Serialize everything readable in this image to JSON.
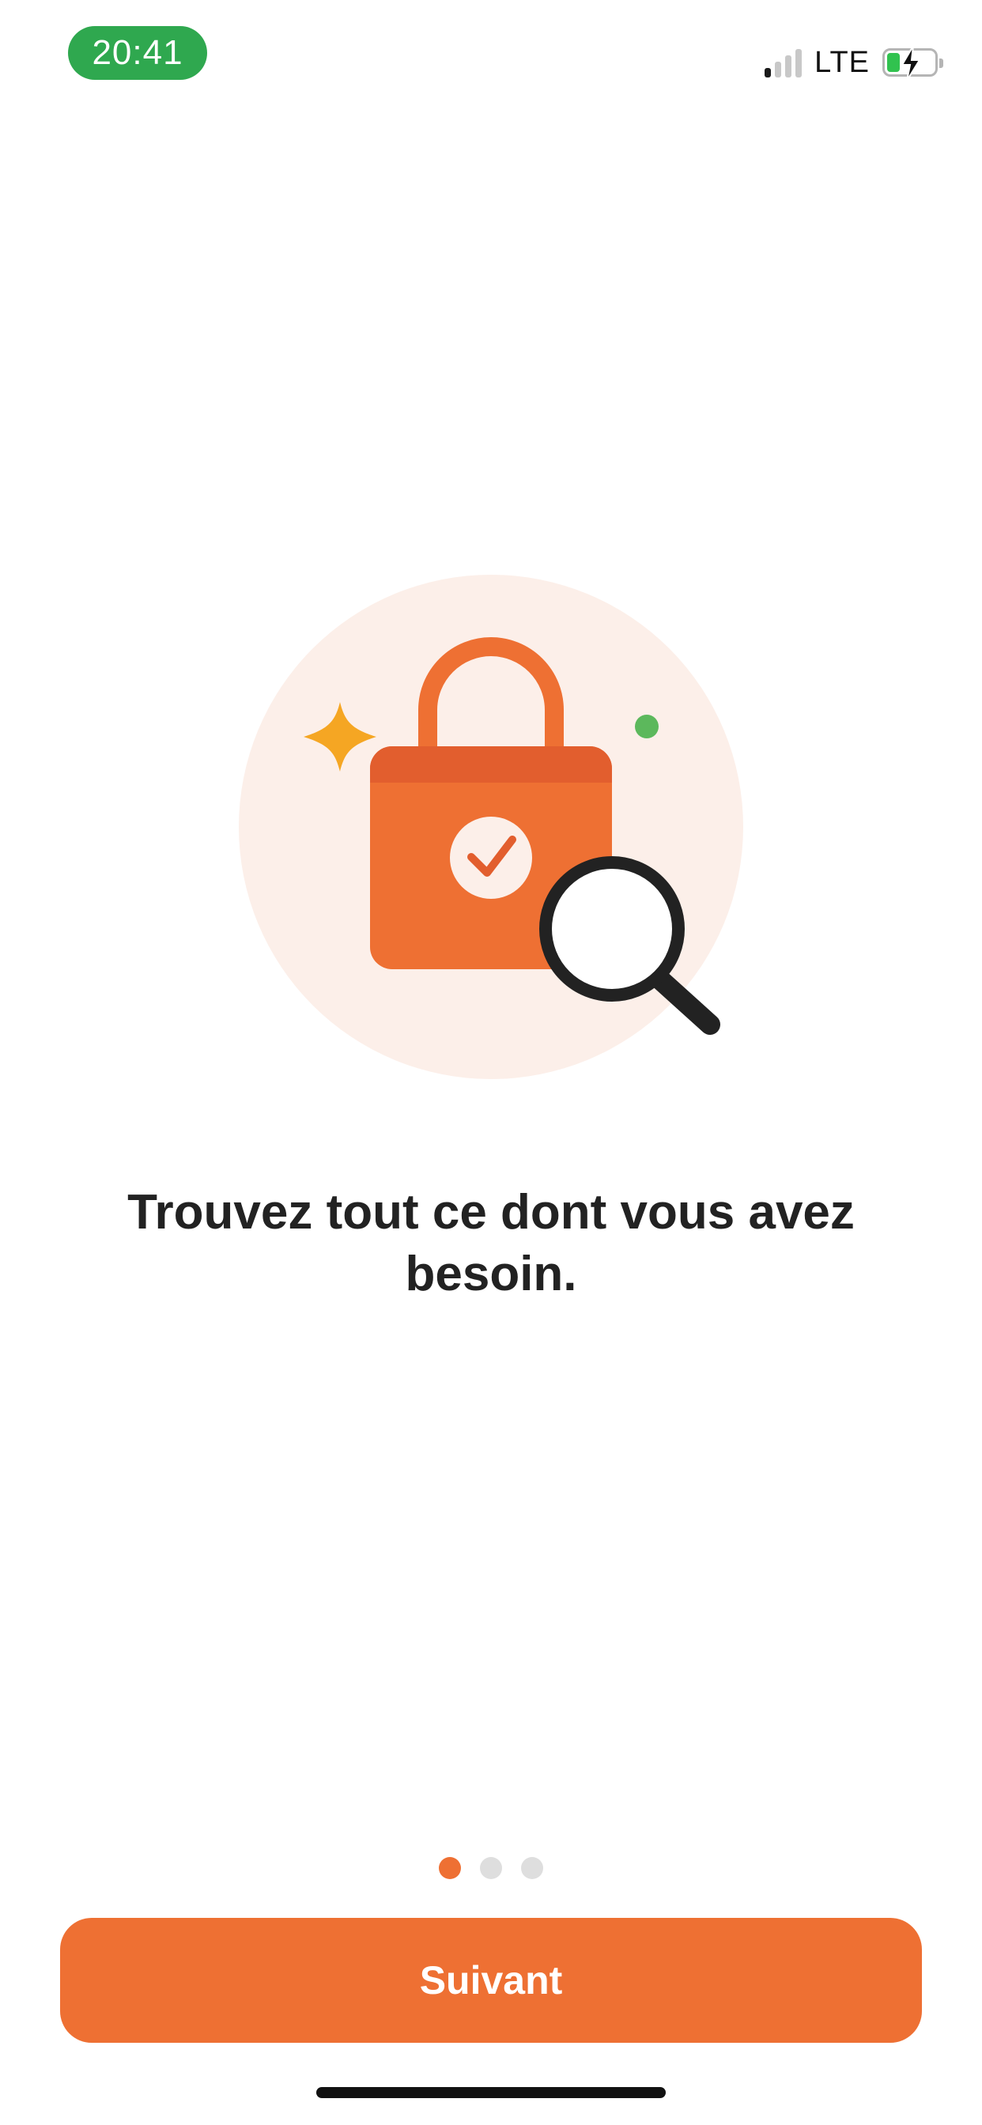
{
  "status_bar": {
    "time": "20:41",
    "network": "LTE",
    "icons": [
      "signal-icon",
      "battery-charging-icon"
    ]
  },
  "illustration": {
    "icons": [
      "padlock-icon",
      "checkmark-icon",
      "magnifier-icon",
      "sparkle-icon",
      "dot-icon"
    ],
    "colors": {
      "circle_bg": "#fcefe9",
      "lock_body": "#ee7033",
      "lock_band": "#e25e2e",
      "sparkle": "#f5a623",
      "green_dot": "#5cb85c",
      "magnifier": "#222222"
    }
  },
  "onboarding": {
    "headline": "Trouvez tout ce dont vous avez besoin.",
    "page_indicator": {
      "current": 1,
      "total": 3
    },
    "next_button_label": "Suivant"
  },
  "theme": {
    "accent": "#ee7033",
    "status_pill": "#2fa84f"
  }
}
